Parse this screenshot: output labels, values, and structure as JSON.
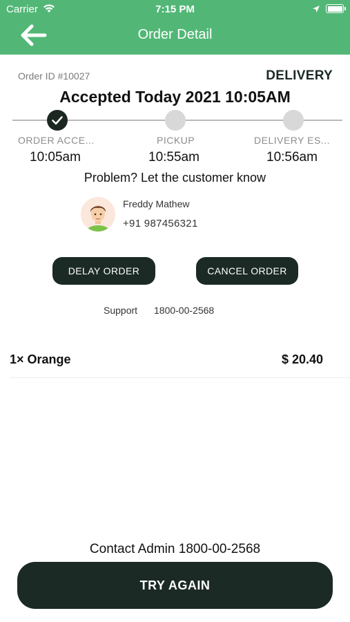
{
  "status_bar": {
    "carrier": "Carrier",
    "time": "7:15 PM"
  },
  "header": {
    "title": "Order Detail",
    "back_icon": "arrow-left-icon"
  },
  "order": {
    "id_label": "Order ID #10027",
    "type": "DELIVERY",
    "accepted_text": "Accepted Today 2021 10:05AM"
  },
  "steps": [
    {
      "label": "ORDER ACCE...",
      "time": "10:05am",
      "state": "done"
    },
    {
      "label": "PICKUP",
      "time": "10:55am",
      "state": "pending"
    },
    {
      "label": "DELIVERY ES...",
      "time": "10:56am",
      "state": "pending"
    }
  ],
  "problem_text": "Problem? Let the customer know",
  "customer": {
    "name": "Freddy Mathew",
    "phone": "+91 987456321"
  },
  "actions": {
    "delay_label": "DELAY ORDER",
    "cancel_label": "CANCEL ORDER"
  },
  "support": {
    "label": "Support",
    "number": "1800-00-2568"
  },
  "items": [
    {
      "name": "1× Orange",
      "price": "$ 20.40"
    }
  ],
  "footer": {
    "contact_text": "Contact Admin 1800-00-2568",
    "try_again_label": "TRY AGAIN"
  },
  "colors": {
    "header_green": "#52b776",
    "button_dark": "#1b2a24"
  }
}
